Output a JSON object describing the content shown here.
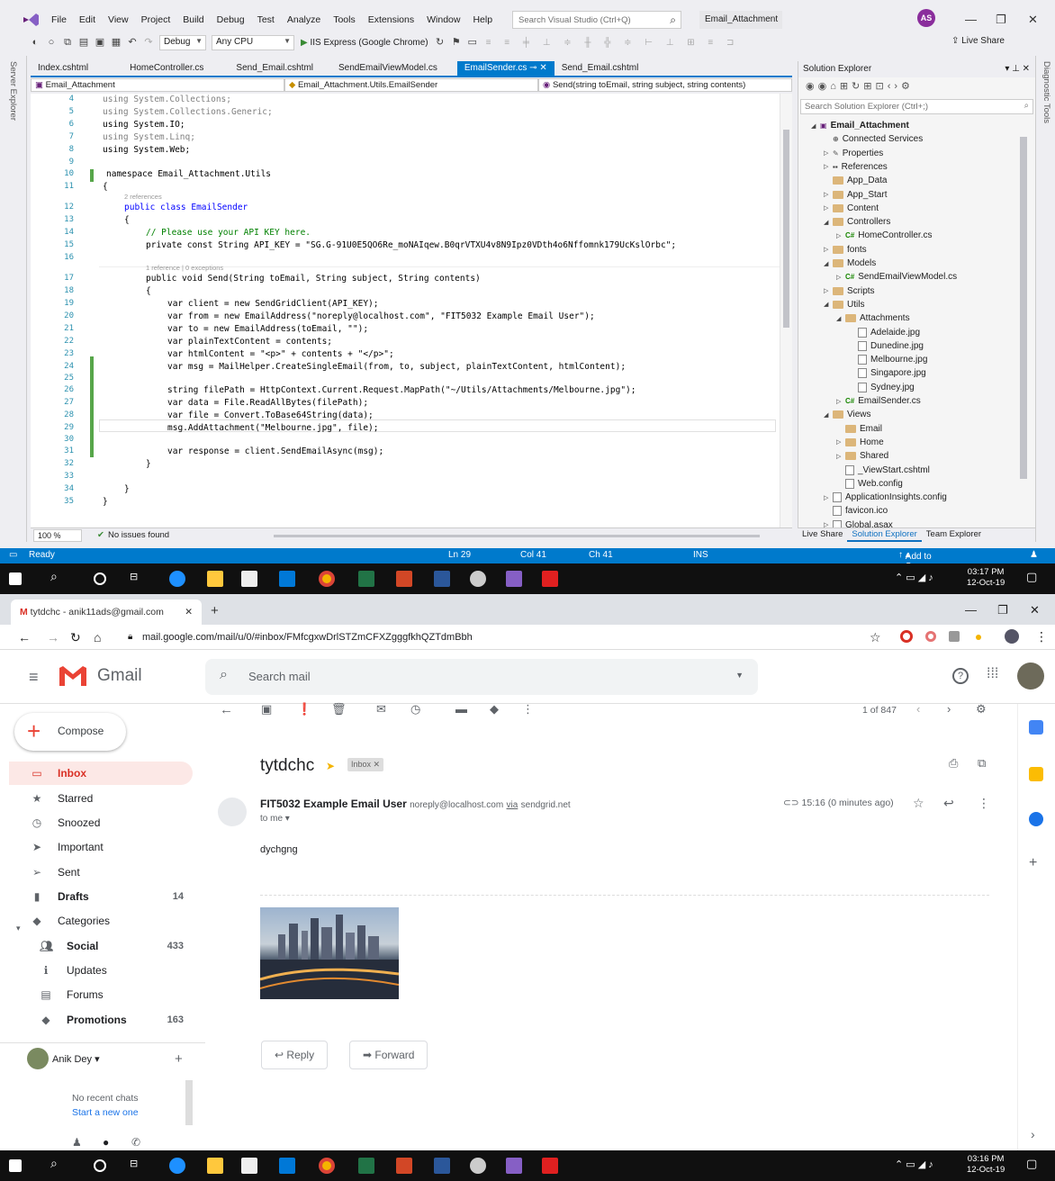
{
  "vs": {
    "menu": [
      "File",
      "Edit",
      "View",
      "Project",
      "Build",
      "Debug",
      "Test",
      "Analyze",
      "Tools",
      "Extensions",
      "Window",
      "Help"
    ],
    "search_placeholder": "Search Visual Studio (Ctrl+Q)",
    "solution_name": "Email_Attachment",
    "avatar": "AS",
    "toolbar": {
      "config": "Debug",
      "platform": "Any CPU",
      "run": "IIS Express (Google Chrome)",
      "liveshare": "Live Share"
    },
    "left_tabs": "Server Explorer",
    "right_tabs": "Diagnostic Tools",
    "tabs": [
      "Index.cshtml",
      "HomeController.cs",
      "Send_Email.cshtml",
      "SendEmailViewModel.cs",
      "EmailSender.cs",
      "Send_Email.cshtml"
    ],
    "nav": {
      "project": "Email_Attachment",
      "class": "Email_Attachment.Utils.EmailSender",
      "member": "Send(string toEmail, string subject, string contents)"
    },
    "codelens": {
      "refs2": "2 references",
      "refs1": "1 reference | 0 exceptions"
    },
    "line_numbers": [
      "4",
      "5",
      "6",
      "7",
      "8",
      "9",
      "10",
      "11",
      "12",
      "13",
      "14",
      "15",
      "16",
      "17",
      "18",
      "19",
      "20",
      "21",
      "22",
      "23",
      "24",
      "25",
      "26",
      "27",
      "28",
      "29",
      "30",
      "31",
      "32",
      "33",
      "34",
      "35"
    ],
    "code": {
      "l4": "using System.Collections;",
      "l5": "using System.Collections.Generic;",
      "l6": "using System.IO;",
      "l7": "using System.Linq;",
      "l8": "using System.Web;",
      "l10": "namespace Email_Attachment.Utils",
      "l11": "{",
      "l12": "public class EmailSender",
      "l13": "{",
      "l14": "// Please use your API KEY here.",
      "l15": "private const String API_KEY = \"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\";",
      "l17": "public void Send(String toEmail, String subject, String contents)",
      "l18": "{",
      "l19": "var client = new SendGridClient(API_KEY);",
      "l20": "var from = new EmailAddress(\"noreply@localhost.com\", \"FIT5032 Example Email User\");",
      "l21": "var to = new EmailAddress(toEmail, \"\");",
      "l22": "var plainTextContent = contents;",
      "l23": "var htmlContent = \"<p>\" + contents + \"</p>\";",
      "l24": "var msg = MailHelper.CreateSingleEmail(from, to, subject, plainTextContent, htmlContent);",
      "l26": "string filePath = HttpContext.Current.Request.MapPath(\"~/Utils/Attachments/Melbourne.jpg\");",
      "l27": "var data = File.ReadAllBytes(filePath);",
      "l28": "var file = Convert.ToBase64String(data);",
      "l29": "msg.AddAttachment(\"Melbourne.jpg\", file);",
      "l31": "var response = client.SendEmailAsync(msg);",
      "l32": "}",
      "l34": "}",
      "l35": "}"
    },
    "editor_status": {
      "zoom": "100 %",
      "issues": "No issues found"
    },
    "solution_explorer": {
      "title": "Solution Explorer",
      "search_placeholder": "Search Solution Explorer (Ctrl+;)",
      "tree": [
        {
          "label": "Email_Attachment",
          "level": 0,
          "kind": "project"
        },
        {
          "label": "Connected Services",
          "level": 1,
          "kind": "service"
        },
        {
          "label": "Properties",
          "level": 1,
          "kind": "prop"
        },
        {
          "label": "References",
          "level": 1,
          "kind": "ref"
        },
        {
          "label": "App_Data",
          "level": 1,
          "kind": "folder"
        },
        {
          "label": "App_Start",
          "level": 1,
          "kind": "folder"
        },
        {
          "label": "Content",
          "level": 1,
          "kind": "folder"
        },
        {
          "label": "Controllers",
          "level": 1,
          "kind": "folder"
        },
        {
          "label": "HomeController.cs",
          "level": 2,
          "kind": "cs"
        },
        {
          "label": "fonts",
          "level": 1,
          "kind": "folder"
        },
        {
          "label": "Models",
          "level": 1,
          "kind": "folder"
        },
        {
          "label": "SendEmailViewModel.cs",
          "level": 2,
          "kind": "cs"
        },
        {
          "label": "Scripts",
          "level": 1,
          "kind": "folder"
        },
        {
          "label": "Utils",
          "level": 1,
          "kind": "folder"
        },
        {
          "label": "Attachments",
          "level": 2,
          "kind": "folder"
        },
        {
          "label": "Adelaide.jpg",
          "level": 3,
          "kind": "img"
        },
        {
          "label": "Dunedine.jpg",
          "level": 3,
          "kind": "img"
        },
        {
          "label": "Melbourne.jpg",
          "level": 3,
          "kind": "img"
        },
        {
          "label": "Singapore.jpg",
          "level": 3,
          "kind": "img"
        },
        {
          "label": "Sydney.jpg",
          "level": 3,
          "kind": "img"
        },
        {
          "label": "EmailSender.cs",
          "level": 2,
          "kind": "cs"
        },
        {
          "label": "Views",
          "level": 1,
          "kind": "folder"
        },
        {
          "label": "Email",
          "level": 2,
          "kind": "folder"
        },
        {
          "label": "Home",
          "level": 2,
          "kind": "folder"
        },
        {
          "label": "Shared",
          "level": 2,
          "kind": "folder"
        },
        {
          "label": "_ViewStart.cshtml",
          "level": 2,
          "kind": "file"
        },
        {
          "label": "Web.config",
          "level": 2,
          "kind": "file"
        },
        {
          "label": "ApplicationInsights.config",
          "level": 1,
          "kind": "file"
        },
        {
          "label": "favicon.ico",
          "level": 1,
          "kind": "file"
        },
        {
          "label": "Global.asax",
          "level": 1,
          "kind": "file"
        }
      ],
      "bottom_tabs": [
        "Live Share",
        "Solution Explorer",
        "Team Explorer"
      ]
    },
    "statusbar": {
      "ready": "Ready",
      "ln": "Ln 29",
      "col": "Col 41",
      "ch": "Ch 41",
      "ins": "INS",
      "source_control": "Add to Source Control"
    },
    "taskbar_time": "03:17 PM",
    "taskbar_date": "12-Oct-19"
  },
  "chrome": {
    "tab_title": "tytdchc - anik11ads@gmail.com",
    "url": "mail.google.com/mail/u/0/#inbox/FMfcgxwDrlSTZmCFXZgggfkhQZTdmBbh",
    "gmail_label": "Gmail",
    "search_placeholder": "Search mail",
    "compose": "Compose",
    "nav": [
      {
        "label": "Inbox",
        "count": "",
        "icon": "inbox-icon",
        "active": true
      },
      {
        "label": "Starred",
        "count": "",
        "icon": "star-icon"
      },
      {
        "label": "Snoozed",
        "count": "",
        "icon": "clock-icon"
      },
      {
        "label": "Important",
        "count": "",
        "icon": "important-icon"
      },
      {
        "label": "Sent",
        "count": "",
        "icon": "send-icon"
      },
      {
        "label": "Drafts",
        "count": "14",
        "icon": "draft-icon",
        "bold": true
      },
      {
        "label": "Categories",
        "count": "",
        "icon": "label-icon"
      },
      {
        "label": "Social",
        "count": "433",
        "icon": "people-icon",
        "bold": true,
        "indent": true
      },
      {
        "label": "Updates",
        "count": "",
        "icon": "info-icon",
        "indent": true
      },
      {
        "label": "Forums",
        "count": "",
        "icon": "forum-icon",
        "indent": true
      },
      {
        "label": "Promotions",
        "count": "163",
        "icon": "tag-icon",
        "bold": true,
        "indent": true
      }
    ],
    "user": "Anik Dey",
    "no_chats": "No recent chats",
    "start_chat": "Start a new one",
    "pagination": "1 of 847",
    "subject": "tytdchc",
    "inbox_badge": "Inbox",
    "sender_name": "FIT5032 Example Email User",
    "sender_email": "noreply@localhost.com",
    "via": "via",
    "via_domain": "sendgrid.net",
    "to_me": "to me",
    "time": "15:16 (0 minutes ago)",
    "body": "dychgng",
    "reply": "Reply",
    "forward": "Forward",
    "taskbar_time": "03:16 PM",
    "taskbar_date": "12-Oct-19"
  }
}
